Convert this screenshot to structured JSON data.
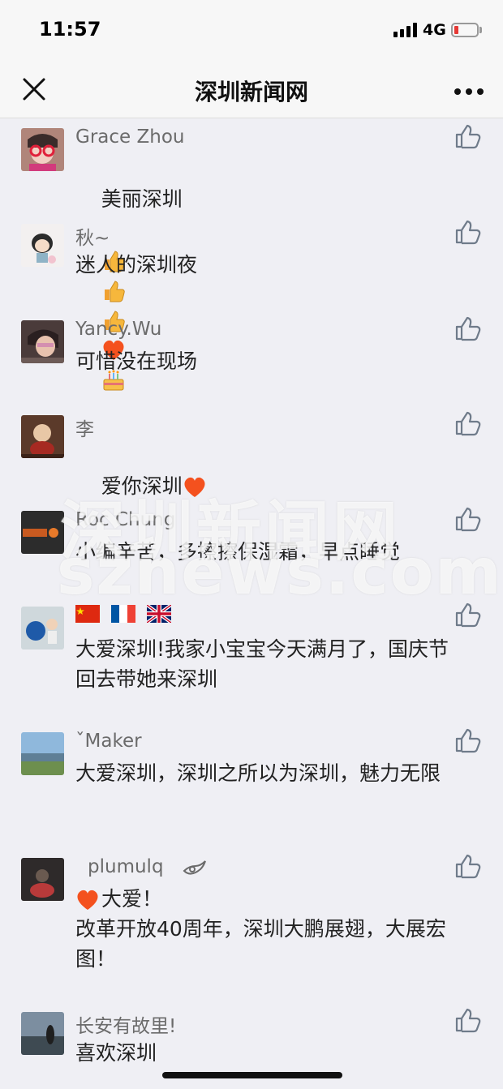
{
  "status": {
    "time": "11:57",
    "network": "4G"
  },
  "nav": {
    "title": "深圳新闻网"
  },
  "watermark": {
    "cn": "深圳新闻网",
    "en": "sznews.com"
  },
  "comments": [
    {
      "name": "Grace Zhou",
      "text": "美丽深圳",
      "avatar": "avatar-grace"
    },
    {
      "name": "秋~",
      "text": "迷人的深圳夜",
      "avatar": "avatar-qiu"
    },
    {
      "name": "Yancy.Wu",
      "text": "可惜没在现场",
      "avatar": "avatar-yancy"
    },
    {
      "name": "李",
      "text": "爱你深圳",
      "avatar": "avatar-li"
    },
    {
      "name": "Roc Chung",
      "text": "小编辛苦，多擦擦保湿霜，早点睡觉",
      "avatar": "avatar-roc"
    },
    {
      "name": "",
      "text": "大爱深圳!我家小宝宝今天满月了，国庆节回去带她来深圳",
      "avatar": "avatar-flags"
    },
    {
      "name": "ˇMaker",
      "text": "大爱深圳，深圳之所以为深圳，魅力无限",
      "avatar": "avatar-maker"
    },
    {
      "name": "plumulq",
      "text": "大爱！\n改革开放40周年，深圳大鹏展翅，大展宏图！",
      "avatar": "avatar-plumulq"
    },
    {
      "name": "长安有故里!",
      "text": "喜欢深圳",
      "avatar": "avatar-changan"
    }
  ],
  "icons": {
    "close": "close-icon",
    "more": "more-icon",
    "like": "thumbs-up-icon",
    "heart": "heart-icon",
    "thumbs_emoji": "thumbs-up-emoji",
    "cake_emoji": "birthday-cake-emoji",
    "flags": [
      "china-flag-icon",
      "france-flag-icon",
      "uk-flag-icon"
    ]
  }
}
